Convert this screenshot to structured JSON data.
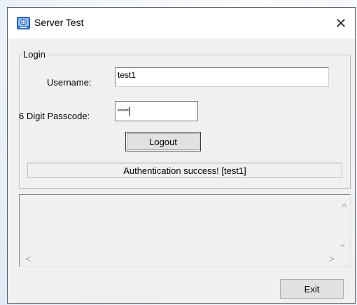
{
  "window": {
    "title": "Server Test",
    "close_glyph": "✕",
    "icon": "app-globe-icon"
  },
  "login": {
    "legend": "Login",
    "username_label": "Username:",
    "username_value": "test1",
    "passcode_label": "6 Digit Passcode:",
    "passcode_value": "******",
    "logout_label": "Logout",
    "status_text": "Authentication success! [test1]"
  },
  "log": {
    "scroll_up": "^",
    "scroll_down": "⌄",
    "scroll_left": "<",
    "scroll_right": ">"
  },
  "footer": {
    "exit_label": "Exit"
  },
  "colors": {
    "window_bg": "#f0f0f0",
    "titlebar_bg": "#ffffff",
    "icon_blue": "#3b78d4"
  }
}
